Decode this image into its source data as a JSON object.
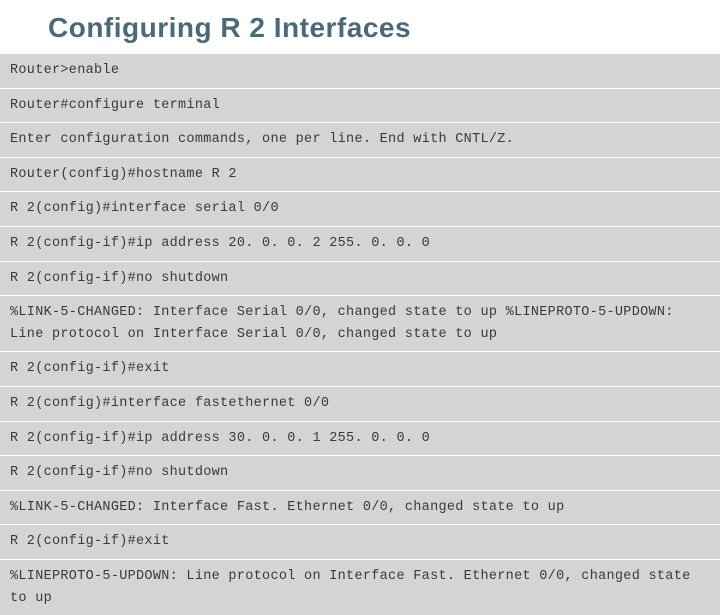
{
  "title": "Configuring R 2 Interfaces",
  "lines": [
    "Router>enable",
    "Router#configure terminal",
    "Enter configuration commands, one per line. End with CNTL/Z.",
    "Router(config)#hostname R 2",
    "R 2(config)#interface serial 0/0",
    "R 2(config-if)#ip address 20. 0. 0. 2 255. 0. 0. 0",
    "R 2(config-if)#no shutdown",
    "%LINK-5-CHANGED: Interface Serial 0/0, changed state to up %LINEPROTO-5-UPDOWN: Line protocol on Interface Serial 0/0, changed state to up",
    "R 2(config-if)#exit",
    "R 2(config)#interface fastethernet 0/0",
    "R 2(config-if)#ip address 30. 0. 0. 1 255. 0. 0. 0",
    "R 2(config-if)#no shutdown",
    "%LINK-5-CHANGED: Interface Fast. Ethernet 0/0, changed state to up",
    "R 2(config-if)#exit",
    "%LINEPROTO-5-UPDOWN: Line protocol on Interface Fast. Ethernet 0/0, changed state to up"
  ]
}
